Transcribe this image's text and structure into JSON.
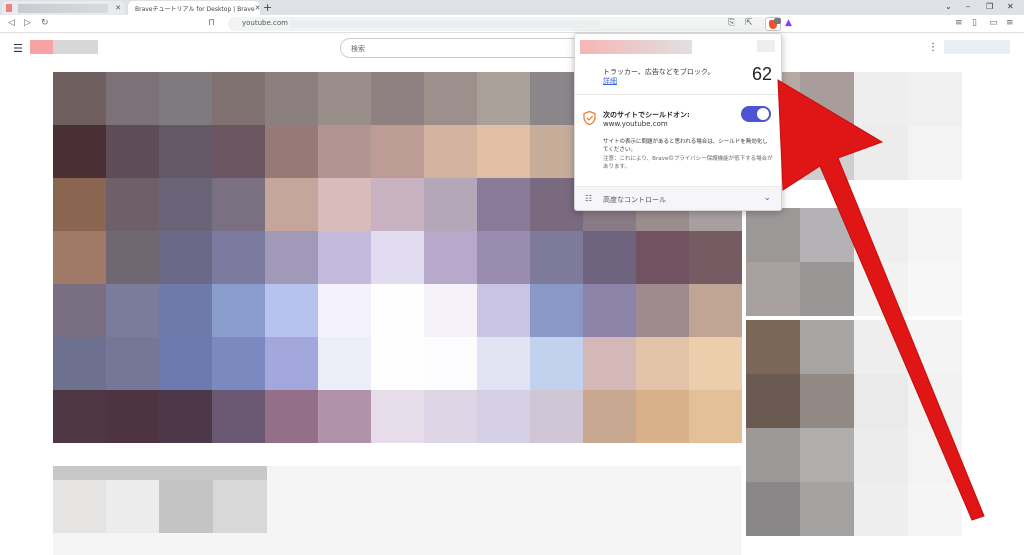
{
  "browser": {
    "tabs": [
      {
        "label": "",
        "active": false
      },
      {
        "label": "Braveチュートリアル for Desktop | Brave",
        "active": true
      }
    ],
    "new_tab": "+",
    "window_controls": [
      "⌄",
      "–",
      "❐",
      "✕"
    ],
    "url": "youtube.com",
    "shields_badge": "",
    "accent": "#fb542b"
  },
  "youtube": {
    "search_placeholder": "検索",
    "menu_icon": "☰",
    "more_icon": "⋮"
  },
  "shields_popup": {
    "blocked_text": "トラッカー、広告などをブロック。",
    "details_link": "詳細",
    "blocked_count": "62",
    "shield_title": "次のサイトでシールドオン:",
    "site": "www.youtube.com",
    "toggle_on": true,
    "description": "サイトの表示に問題があると思われる場合は、シールドを無効化してください。",
    "note": "注意：これにより、Braveのプライバシー保護機能が低下する場合があります。",
    "advanced_controls": "高度なコントロール",
    "toggle_color": "#4c54d2"
  },
  "annotation": {
    "arrow_color": "#e01515"
  }
}
